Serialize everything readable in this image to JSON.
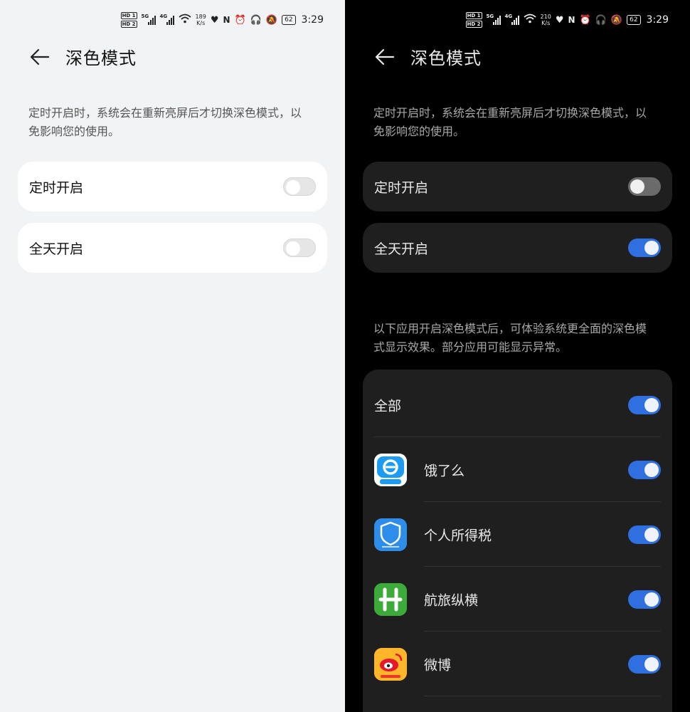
{
  "status_bar": {
    "left_panel": {
      "net_speed": "189",
      "speed_unit": "K/s",
      "battery": "62",
      "time": "3:29"
    },
    "right_panel": {
      "net_speed": "210",
      "speed_unit": "K/s",
      "battery": "62",
      "time": "3:29"
    },
    "sim_labels": [
      "HD 1",
      "HD 2"
    ],
    "network_labels": [
      "5G",
      "4G"
    ]
  },
  "light_panel": {
    "title": "深色模式",
    "description": "定时开启时，系统会在重新亮屏后才切换深色模式，以免影响您的使用。",
    "settings": [
      {
        "label": "定时开启",
        "enabled": false
      },
      {
        "label": "全天开启",
        "enabled": false
      }
    ]
  },
  "dark_panel": {
    "title": "深色模式",
    "description": "定时开启时，系统会在重新亮屏后才切换深色模式，以免影响您的使用。",
    "settings": [
      {
        "label": "定时开启",
        "enabled": false
      },
      {
        "label": "全天开启",
        "enabled": true
      }
    ],
    "apps_description": "以下应用开启深色模式后，可体验系统更全面的深色模式显示效果。部分应用可能显示异常。",
    "all_label": "全部",
    "all_enabled": true,
    "apps": [
      {
        "name": "饿了么",
        "icon": "eleme-app-icon",
        "icon_caption": "不只送餐",
        "enabled": true
      },
      {
        "name": "个人所得税",
        "icon": "tax-app-icon",
        "icon_caption": "国家税务总局",
        "icon_glyph": "税",
        "enabled": true
      },
      {
        "name": "航旅纵横",
        "icon": "umetrip-app-icon",
        "enabled": true
      },
      {
        "name": "微博",
        "icon": "weibo-app-icon",
        "icon_caption": "让江南飞",
        "enabled": true
      }
    ]
  },
  "colors": {
    "accent_blue": "#2f6fe0",
    "dark_card": "#1f1f1f",
    "light_bg": "#f1f3f5"
  }
}
